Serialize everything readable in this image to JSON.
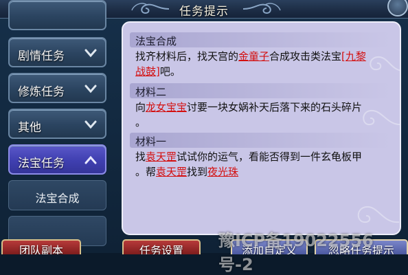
{
  "window": {
    "title": "任务提示"
  },
  "sidebar": {
    "items": [
      {
        "label": "剧情任务",
        "state": "collapsed"
      },
      {
        "label": "修炼任务",
        "state": "collapsed"
      },
      {
        "label": "其他",
        "state": "collapsed"
      },
      {
        "label": "法宝任务",
        "state": "expanded"
      }
    ],
    "subitems": [
      {
        "label": "法宝合成"
      }
    ]
  },
  "content": {
    "sections": [
      {
        "heading": "法宝合成",
        "lines": [
          [
            {
              "t": "找齐材料后，找天宫的"
            },
            {
              "t": "金童子",
              "h": true
            },
            {
              "t": "合成攻击类法宝"
            },
            {
              "t": "[九黎",
              "h": true
            }
          ],
          [
            {
              "t": "战鼓]",
              "h": true
            },
            {
              "t": "吧。"
            }
          ]
        ]
      },
      {
        "heading": "材料二",
        "lines": [
          [
            {
              "t": "向"
            },
            {
              "t": "龙女宝宝",
              "h": true
            },
            {
              "t": "讨要一块女娲补天后落下来的石头碎片"
            }
          ],
          [
            {
              "t": "。"
            }
          ]
        ]
      },
      {
        "heading": "材料一",
        "lines": [
          [
            {
              "t": "找"
            },
            {
              "t": "袁天罡",
              "h": true
            },
            {
              "t": "试试你的运气，看能否得到一件玄龟板甲"
            }
          ],
          [
            {
              "t": "。帮"
            },
            {
              "t": "袁天罡",
              "h": true
            },
            {
              "t": "找到"
            },
            {
              "t": "夜光珠",
              "h": true
            }
          ]
        ]
      }
    ]
  },
  "bottom_buttons": [
    {
      "label": "团队副本",
      "style": "red"
    },
    {
      "label": "任务设置",
      "style": "red"
    },
    {
      "label": "添加自定义",
      "style": "blue"
    },
    {
      "label": "忽略任务提示",
      "style": "blue"
    }
  ],
  "watermark": "豫ICP备19022556号-2",
  "colors": {
    "highlight": "#d40f0f",
    "panel": "#c9c6e7",
    "active_tab": "#4646b8"
  }
}
